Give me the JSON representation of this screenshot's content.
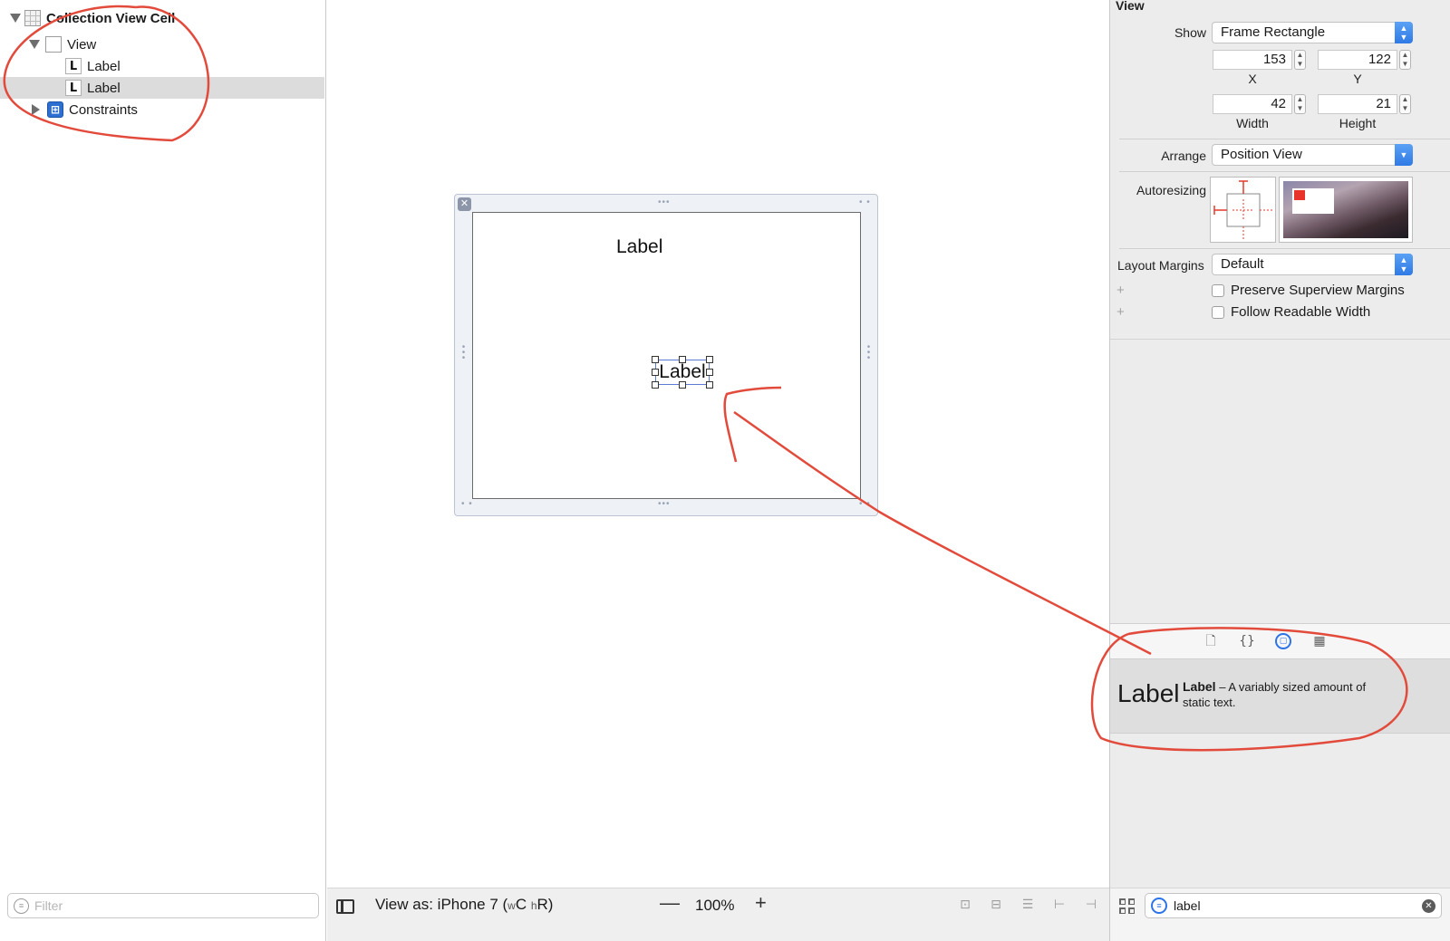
{
  "outline": {
    "items": [
      {
        "label": "Collection View Cell",
        "icon": "collection-view-cell-icon"
      },
      {
        "label": "View",
        "icon": "view-icon"
      },
      {
        "label": "Label",
        "icon": "label-icon",
        "icon_glyph": "L"
      },
      {
        "label": "Label",
        "icon": "label-icon",
        "icon_glyph": "L",
        "selected": true
      },
      {
        "label": "Constraints",
        "icon": "constraints-icon",
        "icon_glyph": "⊞"
      }
    ],
    "filter_placeholder": "Filter"
  },
  "canvas": {
    "labels": [
      "Label",
      "Label"
    ],
    "bottom_bar": {
      "view_as_prefix": "View as: iPhone 7 (",
      "size_w_small": "w",
      "size_w": "C ",
      "size_h_small": "h",
      "size_h": "R)",
      "zoom_out": "—",
      "zoom_level": "100%",
      "zoom_in": "+"
    }
  },
  "inspector": {
    "section_title": "View",
    "show_label": "Show",
    "show_value": "Frame Rectangle",
    "x_value": "153",
    "y_value": "122",
    "x_caption": "X",
    "y_caption": "Y",
    "width_value": "42",
    "height_value": "21",
    "width_caption": "Width",
    "height_caption": "Height",
    "arrange_label": "Arrange",
    "arrange_value": "Position View",
    "autoresizing_label": "Autoresizing",
    "layout_margins_label": "Layout Margins",
    "layout_margins_value": "Default",
    "preserve_label": "Preserve Superview Margins",
    "follow_label": "Follow Readable Width",
    "plus": "+"
  },
  "library": {
    "tabs": [
      "file-template-icon",
      "code-snippet-icon",
      "object-library-icon",
      "media-library-icon"
    ],
    "item_preview": "Label",
    "item_name": "Label",
    "item_desc": " – A variably sized amount of static text.",
    "search_value": "label",
    "clear_glyph": "✕"
  },
  "colors": {
    "accent_blue": "#2c73e8",
    "annotation_red": "#e24a3b",
    "selection_gray": "#dcdcdc"
  }
}
